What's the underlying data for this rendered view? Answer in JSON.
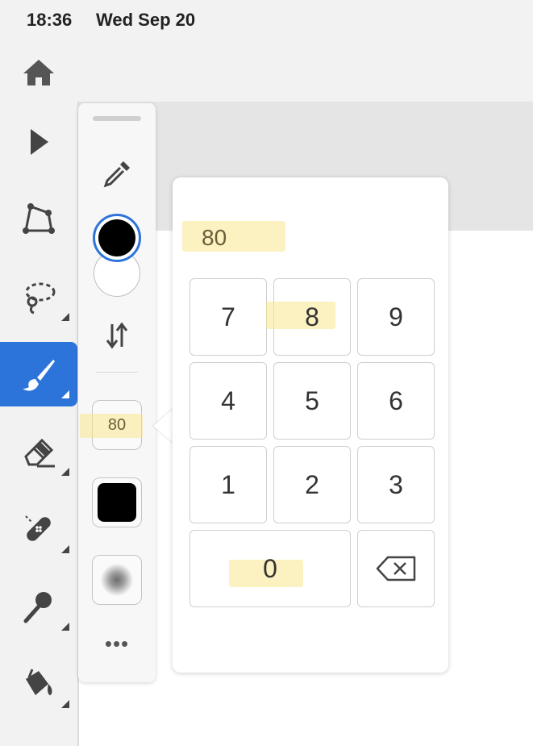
{
  "status_bar": {
    "time": "18:36",
    "date": "Wed Sep 20"
  },
  "topbar": {
    "home_icon": "home-icon"
  },
  "toolbar": {
    "tools": [
      {
        "name": "select",
        "icon": "arrow-pointer-icon"
      },
      {
        "name": "direct-select",
        "icon": "path-anchor-icon"
      },
      {
        "name": "lasso",
        "icon": "lasso-icon"
      },
      {
        "name": "brush",
        "icon": "brush-icon",
        "selected": true
      },
      {
        "name": "eraser",
        "icon": "eraser-icon"
      },
      {
        "name": "healing",
        "icon": "bandage-icon"
      },
      {
        "name": "smudge",
        "icon": "smudge-icon"
      },
      {
        "name": "fill",
        "icon": "paint-bucket-icon"
      }
    ]
  },
  "properties": {
    "eyedropper_icon": "eyedropper-icon",
    "foreground_color": "#000000",
    "background_color": "#ffffff",
    "swap_icon": "swap-arrows-icon",
    "size_value": "80",
    "brush_color": "#000000",
    "more_label": "•••"
  },
  "keypad": {
    "display_value": "80",
    "keys": [
      "7",
      "8",
      "9",
      "4",
      "5",
      "6",
      "1",
      "2",
      "3",
      "0"
    ],
    "backspace_icon": "backspace-icon"
  },
  "colors": {
    "accent": "#2d74da",
    "highlight": "#f9e68c"
  }
}
